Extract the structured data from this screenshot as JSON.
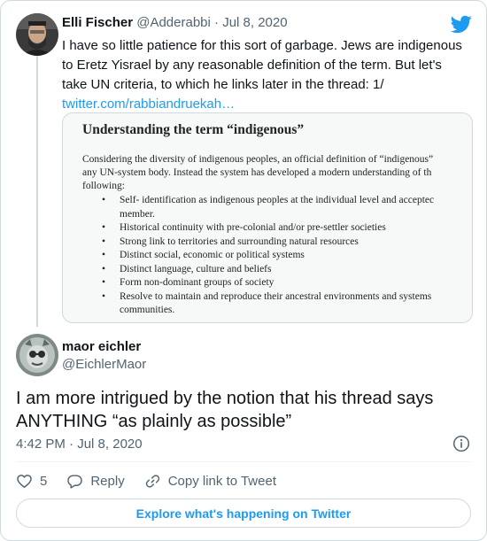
{
  "quoted_tweet": {
    "author_name": "Elli Fischer",
    "handle": "@Adderabbi",
    "separator": "·",
    "date": "Jul 8, 2020",
    "text": "I have so little patience for this sort of garbage. Jews are indigenous to Eretz Yisrael by any reasonable definition of the term. But let's take UN criteria, to which he links later in the thread: 1/",
    "link": "twitter.com/rabbiandruekah…",
    "avatar_icon": "user-avatar",
    "media": {
      "title": "Understanding the term “indigenous”",
      "paragraph_lines": [
        "Considering the diversity of indigenous peoples, an official definition of “indigenous”",
        "any UN-system body. Instead the system has developed a modern understanding of th",
        "following:"
      ],
      "criteria": [
        {
          "line": "Self- identification as indigenous peoples at the individual level and acceptec",
          "cont": "member."
        },
        {
          "line": "Historical continuity with pre-colonial  and/or pre-settler societies",
          "cont": ""
        },
        {
          "line": "Strong link to territories and surrounding natural resources",
          "cont": ""
        },
        {
          "line": "Distinct social, economic or political systems",
          "cont": ""
        },
        {
          "line": "Distinct language, culture and beliefs",
          "cont": ""
        },
        {
          "line": "Form non-dominant groups of society",
          "cont": ""
        },
        {
          "line": "Resolve to maintain and reproduce their ancestral environments and systems",
          "cont": "communities."
        }
      ]
    }
  },
  "reply_tweet": {
    "author_name": "maor eichler",
    "handle": "@EichlerMaor",
    "text": "I am more intrigued by the notion that his thread says ANYTHING “as plainly as possible”",
    "time": "4:42 PM",
    "separator": "·",
    "date": "Jul 8, 2020",
    "avatar_icon": "user-avatar"
  },
  "actions": {
    "like_count": "5",
    "reply_label": "Reply",
    "copy_link_label": "Copy link to Tweet"
  },
  "explore_label": "Explore what's happening on Twitter",
  "colors": {
    "brand": "#1d9bf0",
    "text": "#0f1419",
    "muted": "#536471",
    "border": "#cfd9de"
  },
  "icons": [
    "twitter-bird-icon",
    "info-icon",
    "heart-icon",
    "reply-icon",
    "link-icon"
  ]
}
